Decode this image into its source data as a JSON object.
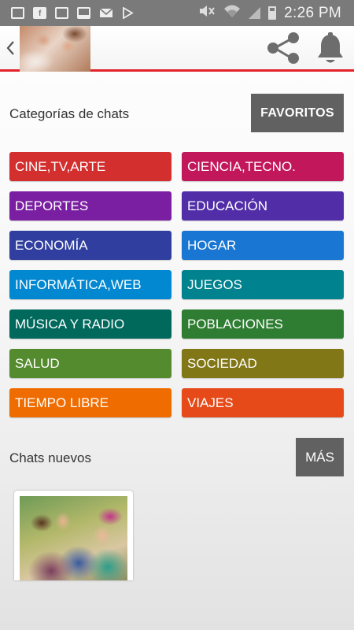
{
  "status_bar": {
    "time": "2:26 PM",
    "left_icons": [
      "s-icon",
      "facebook-icon",
      "image-icon",
      "news-icon",
      "mail-icon",
      "play-store-icon"
    ],
    "right_icons": [
      "mute-icon",
      "wifi-icon",
      "signal-icon",
      "battery-icon"
    ]
  },
  "header": {
    "back_icon": "chevron-left-icon",
    "share_icon": "share-icon",
    "notifications_icon": "bell-icon",
    "accent_color": "#e3212b"
  },
  "categories": {
    "title": "Categorías de chats",
    "favorites_label": "FAVORITOS",
    "items": [
      {
        "label": "CINE,TV,ARTE",
        "color": "#d32f2f"
      },
      {
        "label": "CIENCIA,TECNO.",
        "color": "#c2185b"
      },
      {
        "label": "DEPORTES",
        "color": "#7b1fa2"
      },
      {
        "label": "EDUCACIÓN",
        "color": "#512da8"
      },
      {
        "label": "ECONOMÍA",
        "color": "#303f9f"
      },
      {
        "label": "HOGAR",
        "color": "#1976d2"
      },
      {
        "label": "INFORMÁTICA,WEB",
        "color": "#0288d1"
      },
      {
        "label": "JUEGOS",
        "color": "#00838f"
      },
      {
        "label": "MÚSICA Y RADIO",
        "color": "#00695c"
      },
      {
        "label": "POBLACIONES",
        "color": "#2e7d32"
      },
      {
        "label": "SALUD",
        "color": "#558b2f"
      },
      {
        "label": "SOCIEDAD",
        "color": "#827717"
      },
      {
        "label": "TIEMPO LIBRE",
        "color": "#ef6c00"
      },
      {
        "label": "VIAJES",
        "color": "#e64a19"
      }
    ]
  },
  "new_chats": {
    "title": "Chats nuevos",
    "more_label": "MÁS"
  }
}
